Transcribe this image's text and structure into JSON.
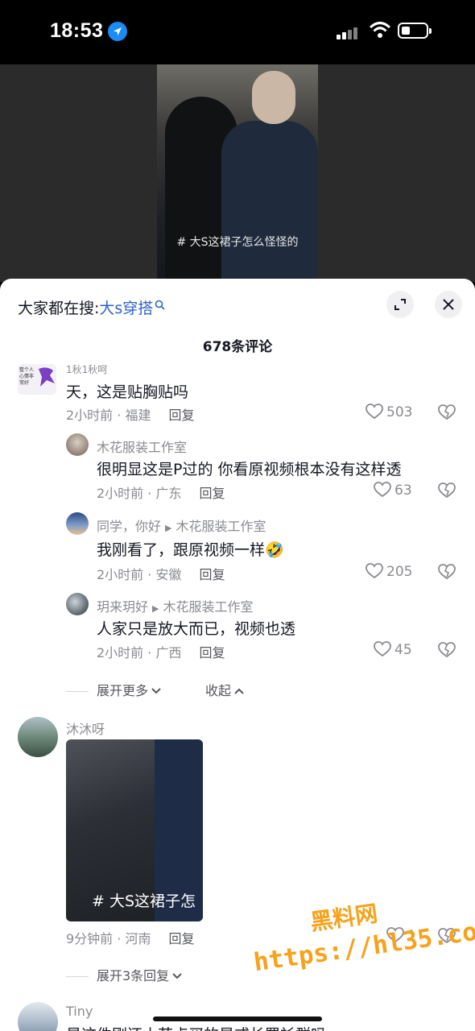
{
  "status_bar": {
    "time": "18:53"
  },
  "video": {
    "caption": "# 大S这裙子怎么怪怪的"
  },
  "search": {
    "prefix": "大家都在搜:",
    "keyword": "大s穿搭"
  },
  "comments_count": "678条评论",
  "comments": [
    {
      "author": "1秋1秋呵",
      "avatar_text": "整个人心情非常好",
      "text": "天，这是贴胸贴吗",
      "time_location": "2小时前 · 福建",
      "reply_label": "回复",
      "likes": "503"
    },
    {
      "author": "木花服装工作室",
      "text": "很明显这是P过的 你看原视频根本没有这样透",
      "time_location": "2小时前 · 广东",
      "reply_label": "回复",
      "likes": "63"
    },
    {
      "author": "同学，你好",
      "reply_to": "木花服装工作室",
      "text": "我刚看了，跟原视频一样🤣",
      "time_location": "2小时前 · 安徽",
      "reply_label": "回复",
      "likes": "205"
    },
    {
      "author": "玥来玥好",
      "reply_to": "木花服装工作室",
      "text": "人家只是放大而已，视频也透",
      "time_location": "2小时前 · 广西",
      "reply_label": "回复",
      "likes": "45"
    },
    {
      "author": "沐沐呀",
      "image_caption": "# 大S这裙子怎",
      "time_location": "9分钟前 · 河南",
      "reply_label": "回复",
      "likes": "1"
    },
    {
      "author": "Tiny",
      "text": "是这件刚还小若点买的是或长罩衫群吗"
    }
  ],
  "thread_controls": {
    "expand_more": "展开更多",
    "collapse": "收起"
  },
  "expand_replies": "展开3条回复",
  "watermark": {
    "line1": "黑料网",
    "line2": "https://hl35.co",
    "color": "#f7a21b"
  }
}
